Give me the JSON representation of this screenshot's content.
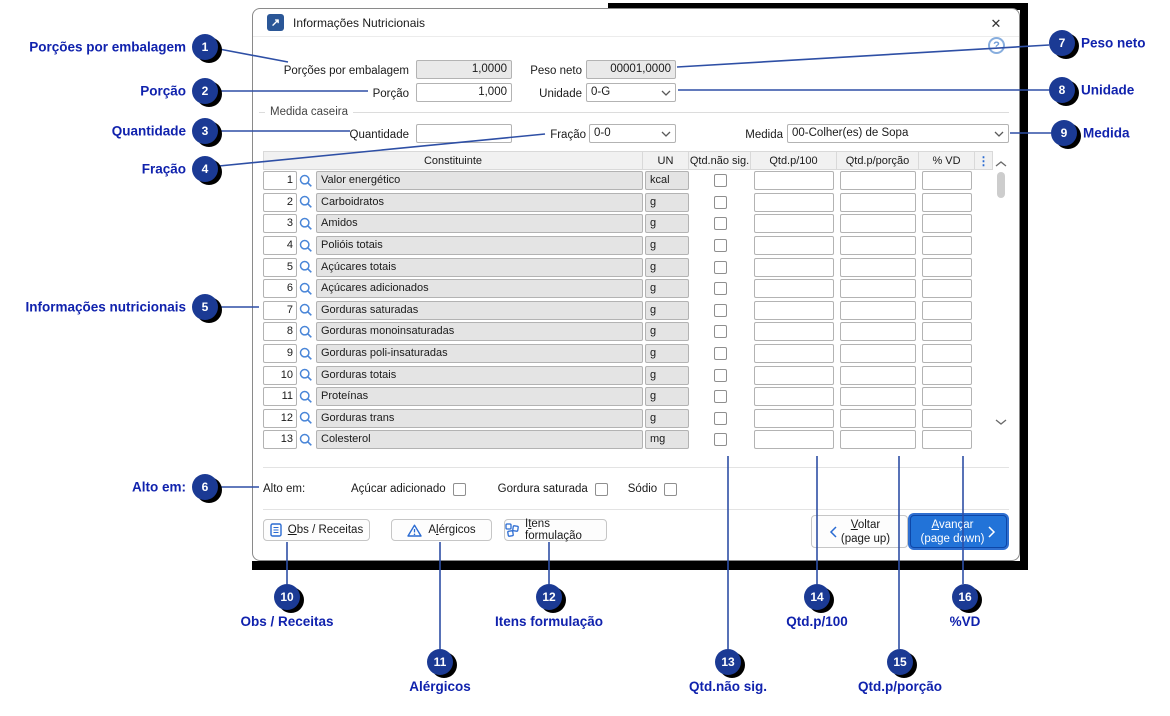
{
  "window": {
    "title": "Informações Nutricionais"
  },
  "icons": {
    "title_arrow": "↗",
    "close": "✕",
    "help": "?",
    "column_menu": "⋮"
  },
  "form": {
    "porcoes_label": "Porções por embalagem",
    "porcoes_value": "1,0000",
    "peso_label": "Peso neto",
    "peso_value": "00001,0000",
    "porcao_label": "Porção",
    "porcao_value": "1,000",
    "unidade_label": "Unidade",
    "unidade_value": "0-G",
    "group_label": "Medida caseira",
    "quantidade_label": "Quantidade",
    "quantidade_value": "",
    "fracao_label": "Fração",
    "fracao_value": "0-0",
    "medida_label": "Medida",
    "medida_value": "00-Colher(es) de Sopa"
  },
  "table": {
    "headers": {
      "constituinte": "Constituinte",
      "un": "UN",
      "qtd_nao_sig": "Qtd.não sig.",
      "qtd_p100": "Qtd.p/100",
      "qtd_pporcao": "Qtd.p/porção",
      "vd": "% VD"
    },
    "rows": [
      {
        "num": "1",
        "name": "Valor energético",
        "un": "kcal"
      },
      {
        "num": "2",
        "name": "Carboidratos",
        "un": "g"
      },
      {
        "num": "3",
        "name": "Amidos",
        "un": "g"
      },
      {
        "num": "4",
        "name": "Polióis totais",
        "un": "g"
      },
      {
        "num": "5",
        "name": "Açúcares totais",
        "un": "g"
      },
      {
        "num": "6",
        "name": "Açúcares adicionados",
        "un": "g"
      },
      {
        "num": "7",
        "name": "Gorduras saturadas",
        "un": "g"
      },
      {
        "num": "8",
        "name": "Gorduras monoinsaturadas",
        "un": "g"
      },
      {
        "num": "9",
        "name": "Gorduras poli-insaturadas",
        "un": "g"
      },
      {
        "num": "10",
        "name": "Gorduras totais",
        "un": "g"
      },
      {
        "num": "11",
        "name": "Proteínas",
        "un": "g"
      },
      {
        "num": "12",
        "name": "Gorduras trans",
        "un": "g"
      },
      {
        "num": "13",
        "name": "Colesterol",
        "un": "mg"
      }
    ]
  },
  "alto_em": {
    "label": "Alto em:",
    "options": [
      "Açúcar adicionado",
      "Gordura saturada",
      "Sódio"
    ]
  },
  "buttons": {
    "obs": "&Obs / Receitas",
    "alergicos": "A&lérgicos",
    "itens": "I&tens formulação",
    "voltar_line1": "&Voltar",
    "voltar_line2": "(page up)",
    "avancar_line1": "&Avançar",
    "avancar_line2": "(page down)"
  },
  "callouts": [
    {
      "num": "1",
      "label": "Porções por embalagem"
    },
    {
      "num": "2",
      "label": "Porção"
    },
    {
      "num": "3",
      "label": "Quantidade"
    },
    {
      "num": "4",
      "label": "Fração"
    },
    {
      "num": "5",
      "label": "Informações nutricionais"
    },
    {
      "num": "6",
      "label": "Alto em:"
    },
    {
      "num": "7",
      "label": "Peso neto"
    },
    {
      "num": "8",
      "label": "Unidade"
    },
    {
      "num": "9",
      "label": "Medida"
    },
    {
      "num": "10",
      "label": "Obs / Receitas"
    },
    {
      "num": "11",
      "label": "Alérgicos"
    },
    {
      "num": "12",
      "label": "Itens formulação"
    },
    {
      "num": "13",
      "label": "Qtd.não sig."
    },
    {
      "num": "14",
      "label": "Qtd.p/100"
    },
    {
      "num": "15",
      "label": "Qtd.p/porção"
    },
    {
      "num": "16",
      "label": "%VD"
    }
  ],
  "colors": {
    "accent_blue": "#2273d8",
    "callout_circle": "#1b3a94",
    "callout_label": "#1022ad",
    "connector_line": "#2e4fa5",
    "title_icon": "#2b5797"
  }
}
